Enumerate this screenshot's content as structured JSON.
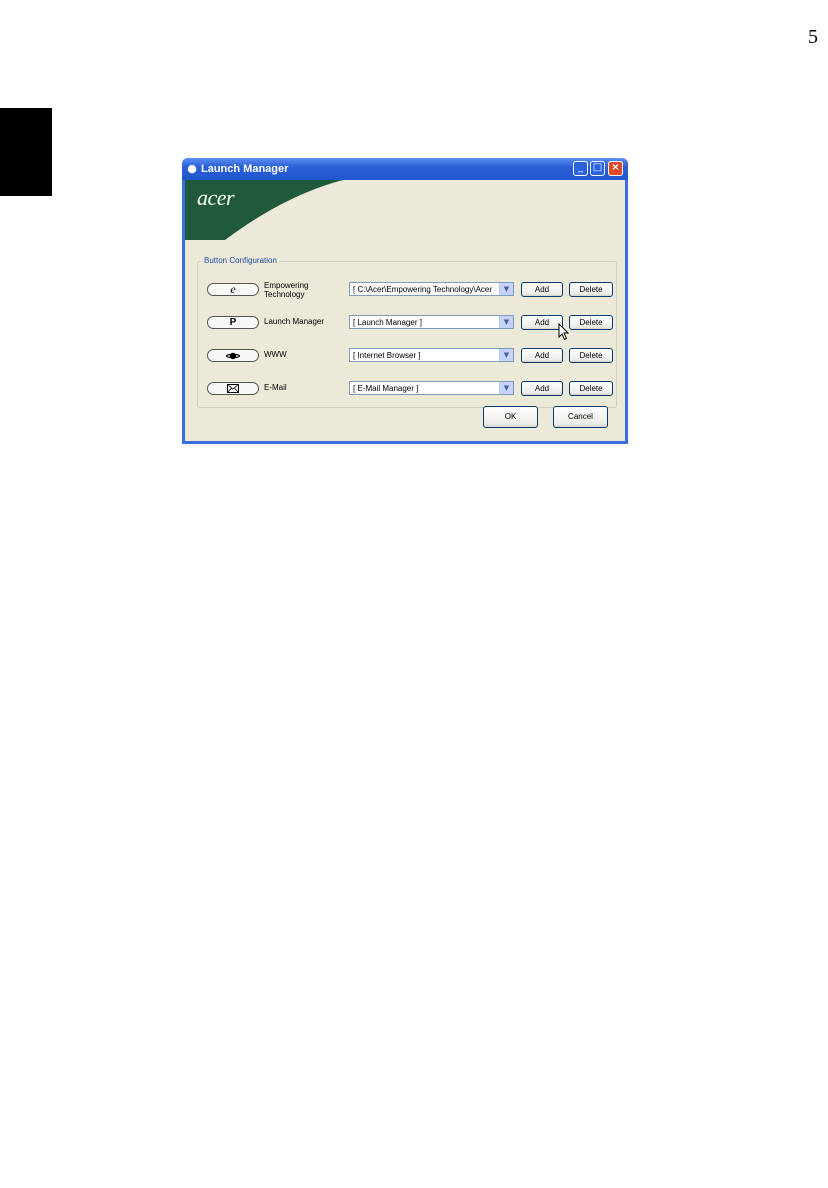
{
  "page": {
    "number": "5"
  },
  "window": {
    "title": "Launch Manager",
    "controls": {
      "minimize": "_",
      "maximize": "□",
      "close": "×"
    }
  },
  "banner": {
    "logo_text": "acer",
    "brand_color": "#1f5a3c"
  },
  "button_configuration": {
    "label": "Button Configuration",
    "rows": [
      {
        "key_symbol": "e",
        "key_label_line1": "Empowering",
        "key_label_line2": "Technology",
        "selected": "[  C:\\Acer\\Empowering Technology\\Acer",
        "add": "Add",
        "delete": "Delete"
      },
      {
        "key_symbol": "P",
        "key_label_line1": "Launch Manager",
        "key_label_line2": "",
        "selected": "[  Launch Manager  ]",
        "add": "Add",
        "delete": "Delete"
      },
      {
        "key_symbol": "planet-icon",
        "key_label_line1": "WWW",
        "key_label_line2": "",
        "selected": "[  Internet Browser  ]",
        "add": "Add",
        "delete": "Delete"
      },
      {
        "key_symbol": "envelope-icon",
        "key_label_line1": "E-Mail",
        "key_label_line2": "",
        "selected": "[  E-Mail Manager  ]",
        "add": "Add",
        "delete": "Delete"
      }
    ]
  },
  "footer": {
    "ok": "OK",
    "cancel": "Cancel"
  }
}
